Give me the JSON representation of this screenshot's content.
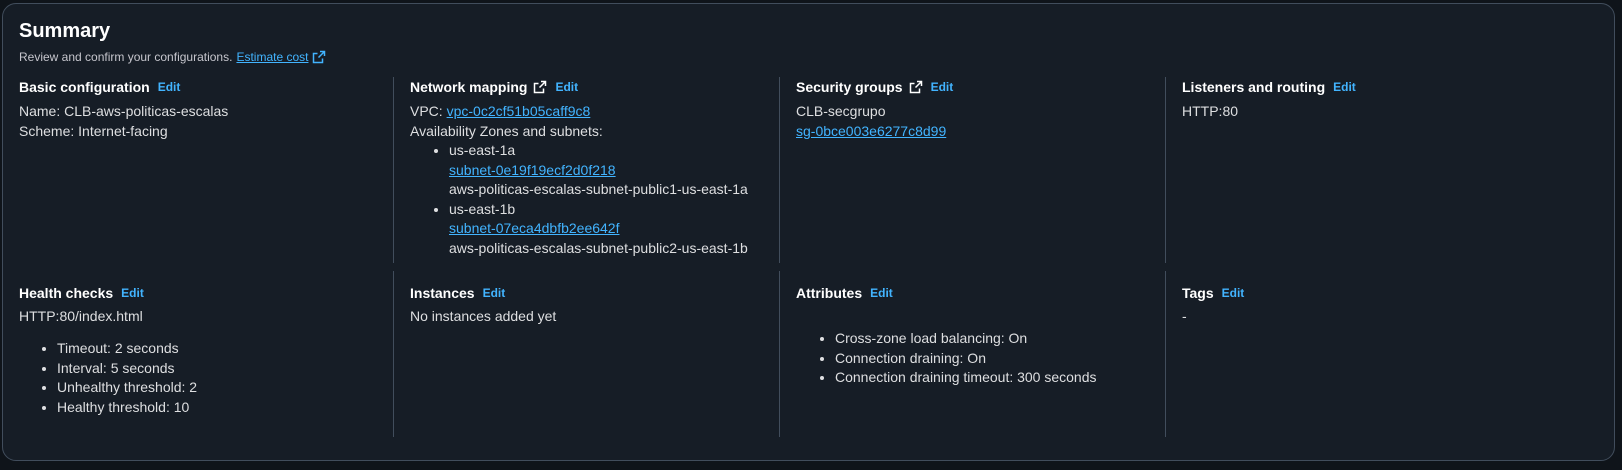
{
  "summary": {
    "title": "Summary",
    "subtitle": "Review and confirm your configurations.",
    "estimate_cost_label": "Estimate cost",
    "edit_label": "Edit"
  },
  "basic": {
    "heading": "Basic configuration",
    "name_line": "Name: CLB-aws-politicas-escalas",
    "scheme_line": "Scheme: Internet-facing"
  },
  "network": {
    "heading": "Network mapping",
    "vpc_label": "VPC: ",
    "vpc_id": "vpc-0c2cf51b05caff9c8",
    "az_label": "Availability Zones and subnets:",
    "zones": [
      {
        "zone": "us-east-1a",
        "subnet_id": "subnet-0e19f19ecf2d0f218",
        "subnet_name": "aws-politicas-escalas-subnet-public1-us-east-1a"
      },
      {
        "zone": "us-east-1b",
        "subnet_id": "subnet-07eca4dbfb2ee642f",
        "subnet_name": "aws-politicas-escalas-subnet-public2-us-east-1b"
      }
    ]
  },
  "security": {
    "heading": "Security groups",
    "group_name": "CLB-secgrupo",
    "group_id": "sg-0bce003e6277c8d99"
  },
  "listeners": {
    "heading": "Listeners and routing",
    "value": "HTTP:80"
  },
  "health": {
    "heading": "Health checks",
    "path": "HTTP:80/index.html",
    "items": [
      "Timeout: 2 seconds",
      "Interval: 5 seconds",
      "Unhealthy threshold: 2",
      "Healthy threshold: 10"
    ]
  },
  "instances": {
    "heading": "Instances",
    "value": "No instances added yet"
  },
  "attributes": {
    "heading": "Attributes",
    "items": [
      "Cross-zone load balancing: On",
      "Connection draining: On",
      "Connection draining timeout: 300 seconds"
    ]
  },
  "tags": {
    "heading": "Tags",
    "value": "-"
  },
  "colors": {
    "background": "#161d26",
    "link": "#42b4ff",
    "border": "#414d5c"
  },
  "icons": [
    "external-link-icon"
  ]
}
